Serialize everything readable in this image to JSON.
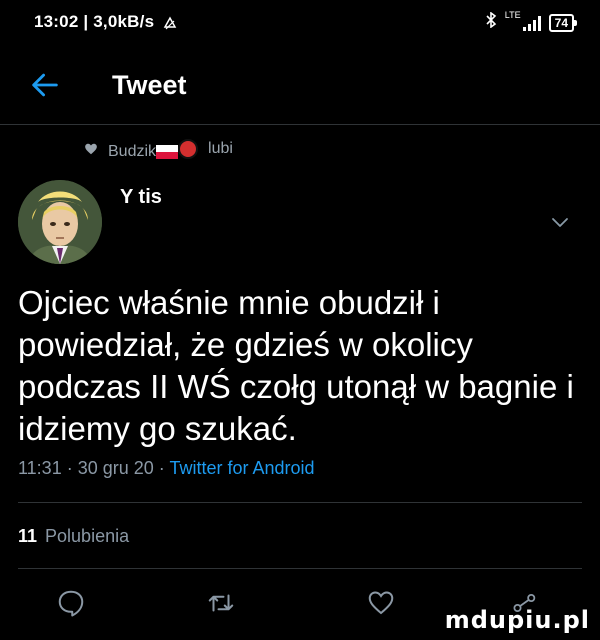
{
  "status_bar": {
    "time": "13:02 | 3,0kB/s",
    "network": "LTE",
    "battery": "74"
  },
  "header": {
    "title": "Tweet"
  },
  "social_context": {
    "liker": "Budzik",
    "action": "lubi"
  },
  "author": {
    "name": "Y   tis"
  },
  "tweet": {
    "text": "Ojciec właśnie mnie obudził i powiedział, że gdzieś w okolicy podczas II WŚ czołg utonął w bagnie i idziemy go szukać.",
    "time": "11:31",
    "date": "30 gru 20",
    "source": "Twitter for Android",
    "likes_count": "11",
    "likes_label": "Polubienia"
  },
  "watermark": "mdupiu.pl",
  "colors": {
    "accent": "#1d9bf0",
    "muted": "#8b98a5",
    "background": "#000000"
  }
}
